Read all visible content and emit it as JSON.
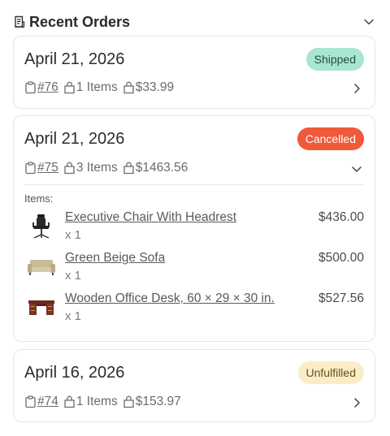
{
  "header": {
    "title": "Recent Orders",
    "icon": "receipt-icon",
    "collapse_icon": "chevron-down-icon"
  },
  "orders": [
    {
      "date": "April 21, 2026",
      "status": "Shipped",
      "number": "#76",
      "items_count": "1 Items",
      "total": "$33.99",
      "expanded": false
    },
    {
      "date": "April 21, 2026",
      "status": "Cancelled",
      "number": "#75",
      "items_count": "3 Items",
      "total": "$1463.56",
      "expanded": true,
      "items_label": "Items:",
      "items": [
        {
          "name": "Executive Chair With Headrest",
          "qty": "x 1",
          "price": "$436.00",
          "thumb": "office-chair-image"
        },
        {
          "name": "Green Beige Sofa",
          "qty": "x 1",
          "price": "$500.00",
          "thumb": "sofa-image"
        },
        {
          "name": "Wooden Office Desk, 60 × 29 × 30 in.",
          "qty": "x 1",
          "price": "$527.56",
          "thumb": "desk-image"
        }
      ]
    },
    {
      "date": "April 16, 2026",
      "status": "Unfulfilled",
      "number": "#74",
      "items_count": "1 Items",
      "total": "$153.97",
      "expanded": false
    }
  ],
  "colors": {
    "shipped_bg": "#a9e6d0",
    "cancelled_bg": "#ef5a3a",
    "unfulfilled_bg": "#fbecc8",
    "border": "#e6e6e6"
  }
}
